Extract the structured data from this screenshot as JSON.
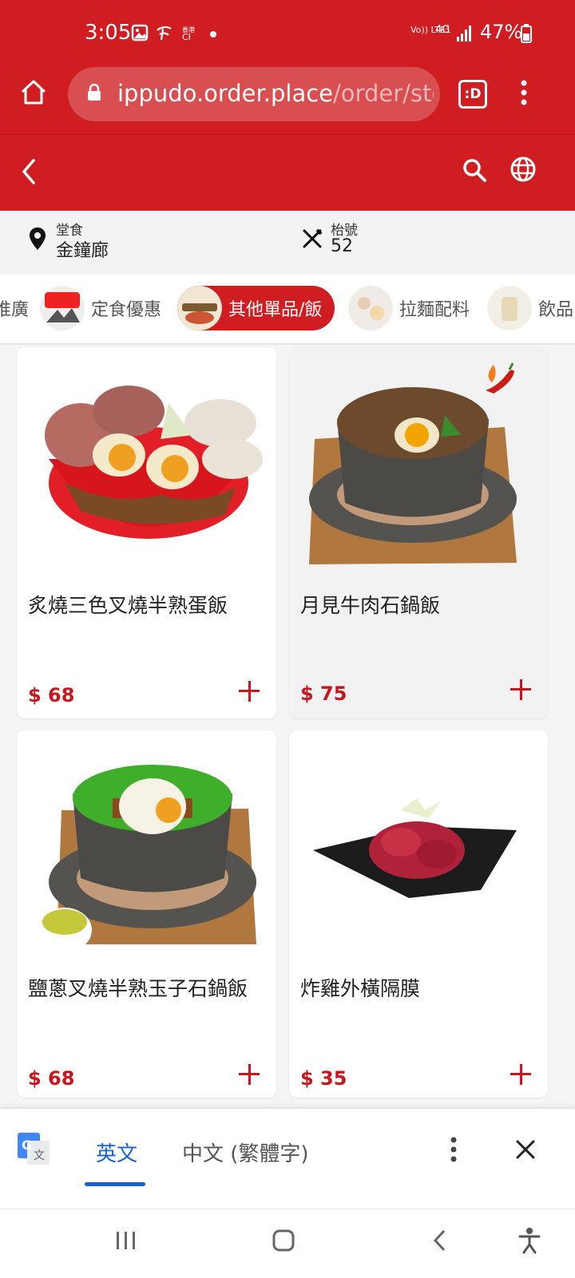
{
  "status_bar": {
    "time": "3:05",
    "network": "Vo)) LTE1",
    "net_type": "4G",
    "battery": "47%"
  },
  "browser": {
    "url_main": "ippudo.order.place",
    "url_rest": "/order/stc",
    "tab_label": ":D"
  },
  "info": {
    "dining_label": "堂食",
    "location": "金鐘廊",
    "table_label": "枱號",
    "table_number": "52"
  },
  "categories": [
    {
      "label": "推廣"
    },
    {
      "label": "定食優惠"
    },
    {
      "label": "其他單品/飯"
    },
    {
      "label": "拉麵配料"
    },
    {
      "label": "飲品"
    }
  ],
  "menu_items": [
    {
      "name": "炙燒三色叉燒半熟蛋飯",
      "price": "$ 68"
    },
    {
      "name": "月見牛肉石鍋飯",
      "price": "$ 75"
    },
    {
      "name": "鹽蔥叉燒半熟玉子石鍋飯",
      "price": "$ 68"
    },
    {
      "name": "炸雞外橫隔膜",
      "price": "$ 35"
    }
  ],
  "translate": {
    "lang_source": "英文",
    "lang_target": "中文 (繁體字)"
  },
  "colors": {
    "brand_red": "#cf1d21",
    "price_red": "#c8161d"
  }
}
